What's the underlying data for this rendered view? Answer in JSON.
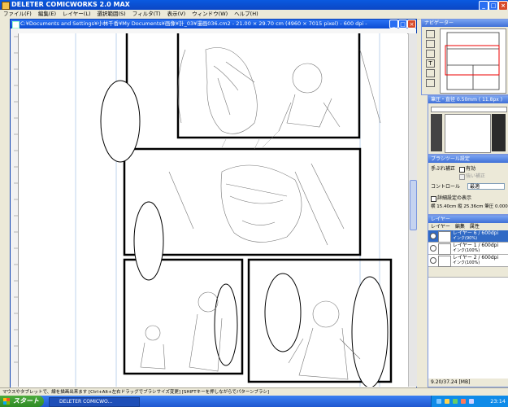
{
  "window": {
    "title": "DELETER COMICWORKS 2.0 MAX"
  },
  "menu": [
    "ファイル(F)",
    "編集(E)",
    "レイヤー(L)",
    "選択範囲(S)",
    "フィルタ(T)",
    "表示(V)",
    "ウィンドウ(W)",
    "ヘルプ(H)"
  ],
  "document": {
    "title": "C:¥Documents and Settings¥小林千香¥My Documents¥画像¥計_03¥漫画036.cm2 - 21.00 × 29.70 cm (4960 × 7015 pixel) - 600 dpi -"
  },
  "navigator": {
    "title": "ナビゲーター"
  },
  "brush_panel": {
    "title": "筆圧・直径 0.50mm ( 11.8px )"
  },
  "brush_settings": {
    "title": "ブラシツール設定",
    "correction_label": "手ぶれ補正",
    "enabled_label": "有効",
    "strong_label": "強い補正",
    "control_label": "コントロール",
    "control_value": "最適",
    "detail_label": "詳細設定の表示",
    "size_text": "横 15.40cm 縦 25.36cm 筆圧 0.000"
  },
  "layers_panel": {
    "title": "レイヤー",
    "tabs": [
      "レイヤー",
      "編集",
      "属性"
    ],
    "layers": [
      {
        "name": "レイヤー 6 / 600dpi",
        "sub": "インク(90%)"
      },
      {
        "name": "レイヤー 1 / 600dpi",
        "sub": "インク(100%)"
      },
      {
        "name": "レイヤー 2 / 600dpi",
        "sub": "インク(100%)"
      }
    ],
    "memory": "9.20/37.24 [MB]"
  },
  "statusbar": {
    "text": "マウスやタブレットで、線を描画出来ます [Ctrl+Alt+左右ドラッグでブラシサイズ変更] [SHIFTキーを押しながらでパターンブラシ]"
  },
  "taskbar": {
    "start": "スタート",
    "app": "DELETER COMICWO...",
    "clock": "23:14"
  }
}
